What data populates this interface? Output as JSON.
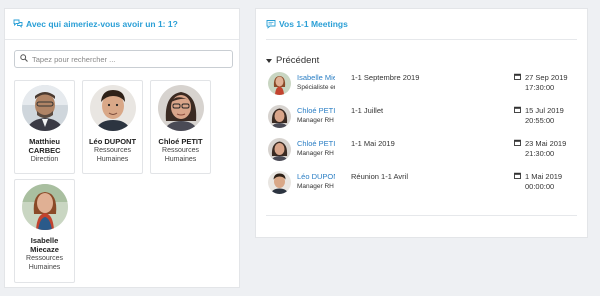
{
  "left": {
    "title": "Avec qui aimeriez-vous avoir un 1: 1?",
    "search_placeholder": "Tapez pour rechercher ...",
    "people": [
      {
        "name": "Matthieu CARBEC",
        "role": "Direction"
      },
      {
        "name": "Léo DUPONT",
        "role": "Ressources Humaines"
      },
      {
        "name": "Chloé PETIT",
        "role": "Ressources Humaines"
      },
      {
        "name": "Isabelle Miecaze",
        "role": "Ressources Humaines"
      }
    ]
  },
  "right": {
    "title": "Vos 1-1 Meetings",
    "section": "Précédent",
    "meetings": [
      {
        "name": "Isabelle Miecaze",
        "role": "Spécialiste en",
        "title": "1-1 Septembre 2019",
        "date": "27 Sep 2019",
        "time": "17:30:00"
      },
      {
        "name": "Chloé PETIT",
        "role": "Manager RH",
        "title": "1-1 Juillet",
        "date": "15 Jul 2019",
        "time": "20:55:00"
      },
      {
        "name": "Chloé PETIT",
        "role": "Manager RH",
        "title": "1-1 Mai 2019",
        "date": "23 Mai 2019",
        "time": "21:30:00"
      },
      {
        "name": "Léo DUPONT",
        "role": "Manager RH",
        "title": "Réunion 1-1 Avril",
        "date": "1 Mai 2019",
        "time": "00:00:00"
      }
    ]
  },
  "icons": {
    "chat": "chat-bubbles-icon",
    "search": "search-icon",
    "meetings": "message-square-icon",
    "calendar": "calendar-icon"
  },
  "colors": {
    "accent": "#2a9fd6",
    "link": "#2a7ec4"
  }
}
